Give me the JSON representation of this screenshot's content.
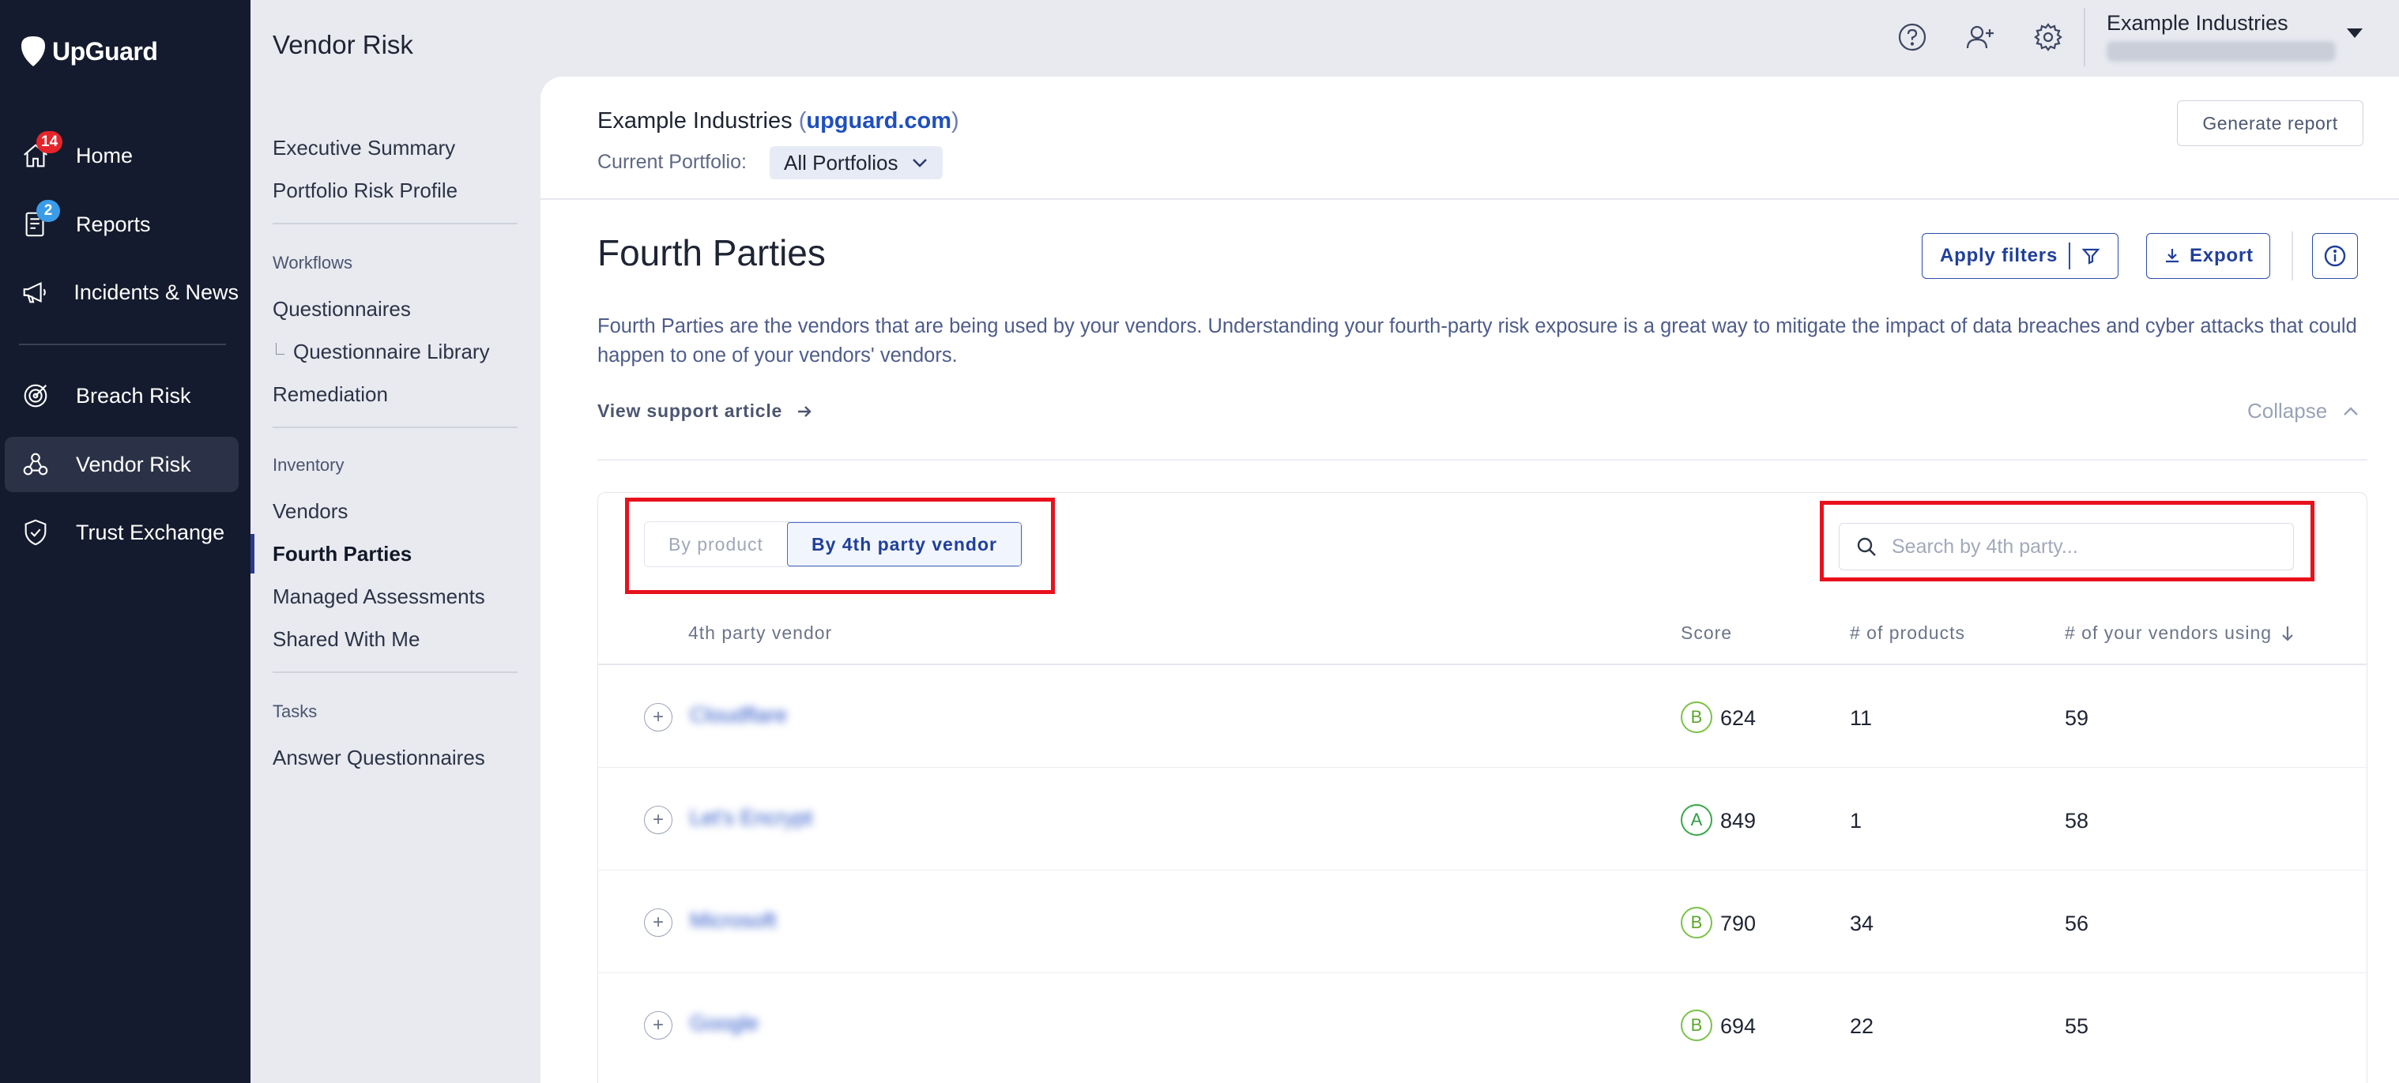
{
  "app": {
    "logo_text": "UpGuard"
  },
  "leftnav": {
    "items": [
      {
        "label": "Home",
        "badge": "14",
        "icon": "home-icon"
      },
      {
        "label": "Reports",
        "badge": "2",
        "icon": "reports-icon"
      },
      {
        "label": "Incidents & News",
        "icon": "megaphone-icon"
      },
      {
        "label": "Breach Risk",
        "icon": "target-icon"
      },
      {
        "label": "Vendor Risk",
        "icon": "vendor-network-icon",
        "active": true
      },
      {
        "label": "Trust Exchange",
        "icon": "shield-check-icon"
      }
    ]
  },
  "subnav": {
    "title": "Vendor Risk",
    "top_items": [
      "Executive Summary",
      "Portfolio Risk Profile"
    ],
    "workflows_heading": "Workflows",
    "workflows": [
      "Questionnaires",
      "Questionnaire Library",
      "Remediation"
    ],
    "inventory_heading": "Inventory",
    "inventory": [
      "Vendors",
      "Fourth Parties",
      "Managed Assessments",
      "Shared With Me"
    ],
    "tasks_heading": "Tasks",
    "tasks": [
      "Answer Questionnaires"
    ]
  },
  "topbar": {
    "org_name": "Example Industries"
  },
  "header": {
    "org_name": "Example Industries",
    "org_domain": "upguard.com",
    "portfolio_label": "Current Portfolio:",
    "portfolio_value": "All Portfolios",
    "generate_report": "Generate report"
  },
  "page": {
    "title": "Fourth Parties",
    "apply_filters": "Apply filters",
    "export": "Export",
    "description": "Fourth Parties are the vendors that are being used by your vendors. Understanding your fourth-party risk exposure is a great way to mitigate the impact of data breaches and cyber attacks that could happen to one of your vendors' vendors.",
    "support_link": "View support article",
    "collapse": "Collapse"
  },
  "table": {
    "toggle": {
      "by_product": "By product",
      "by_vendor": "By 4th party vendor",
      "selected": "By 4th party vendor"
    },
    "search_placeholder": "Search by 4th party...",
    "columns": {
      "vendor": "4th party vendor",
      "score": "Score",
      "products": "# of products",
      "vendors_using": "# of your vendors using"
    },
    "rows": [
      {
        "name": "Cloudflare",
        "grade": "B",
        "score": "624",
        "products": "11",
        "vendors_using": "59"
      },
      {
        "name": "Let's Encrypt",
        "grade": "A",
        "score": "849",
        "products": "1",
        "vendors_using": "58"
      },
      {
        "name": "Microsoft",
        "grade": "B",
        "score": "790",
        "products": "34",
        "vendors_using": "56"
      },
      {
        "name": "Google",
        "grade": "B",
        "score": "694",
        "products": "22",
        "vendors_using": "55"
      }
    ]
  },
  "colors": {
    "nav_bg": "#141b2e",
    "accent": "#1f3f9a",
    "highlight": "#e8111c"
  }
}
